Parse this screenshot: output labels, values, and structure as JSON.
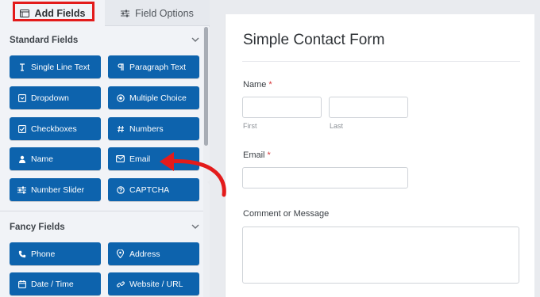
{
  "tabs": {
    "add_fields": "Add Fields",
    "field_options": "Field Options"
  },
  "standard_fields": {
    "title": "Standard Fields",
    "items": [
      {
        "label": "Single Line Text",
        "icon": "text-cursor-icon"
      },
      {
        "label": "Paragraph Text",
        "icon": "paragraph-icon"
      },
      {
        "label": "Dropdown",
        "icon": "dropdown-icon"
      },
      {
        "label": "Multiple Choice",
        "icon": "radio-icon"
      },
      {
        "label": "Checkboxes",
        "icon": "checkbox-icon"
      },
      {
        "label": "Numbers",
        "icon": "hash-icon"
      },
      {
        "label": "Name",
        "icon": "user-icon"
      },
      {
        "label": "Email",
        "icon": "envelope-icon"
      },
      {
        "label": "Number Slider",
        "icon": "slider-icon"
      },
      {
        "label": "CAPTCHA",
        "icon": "question-circle-icon"
      }
    ]
  },
  "fancy_fields": {
    "title": "Fancy Fields",
    "items": [
      {
        "label": "Phone",
        "icon": "phone-icon"
      },
      {
        "label": "Address",
        "icon": "map-pin-icon"
      },
      {
        "label": "Date / Time",
        "icon": "calendar-icon"
      },
      {
        "label": "Website / URL",
        "icon": "link-icon"
      }
    ]
  },
  "form": {
    "title": "Simple Contact Form",
    "name_label": "Name",
    "required_mark": "*",
    "first_sub": "First",
    "last_sub": "Last",
    "email_label": "Email",
    "comment_label": "Comment or Message"
  },
  "colors": {
    "button": "#0d63ad",
    "highlight": "#e31b1b",
    "required": "#d63638"
  }
}
